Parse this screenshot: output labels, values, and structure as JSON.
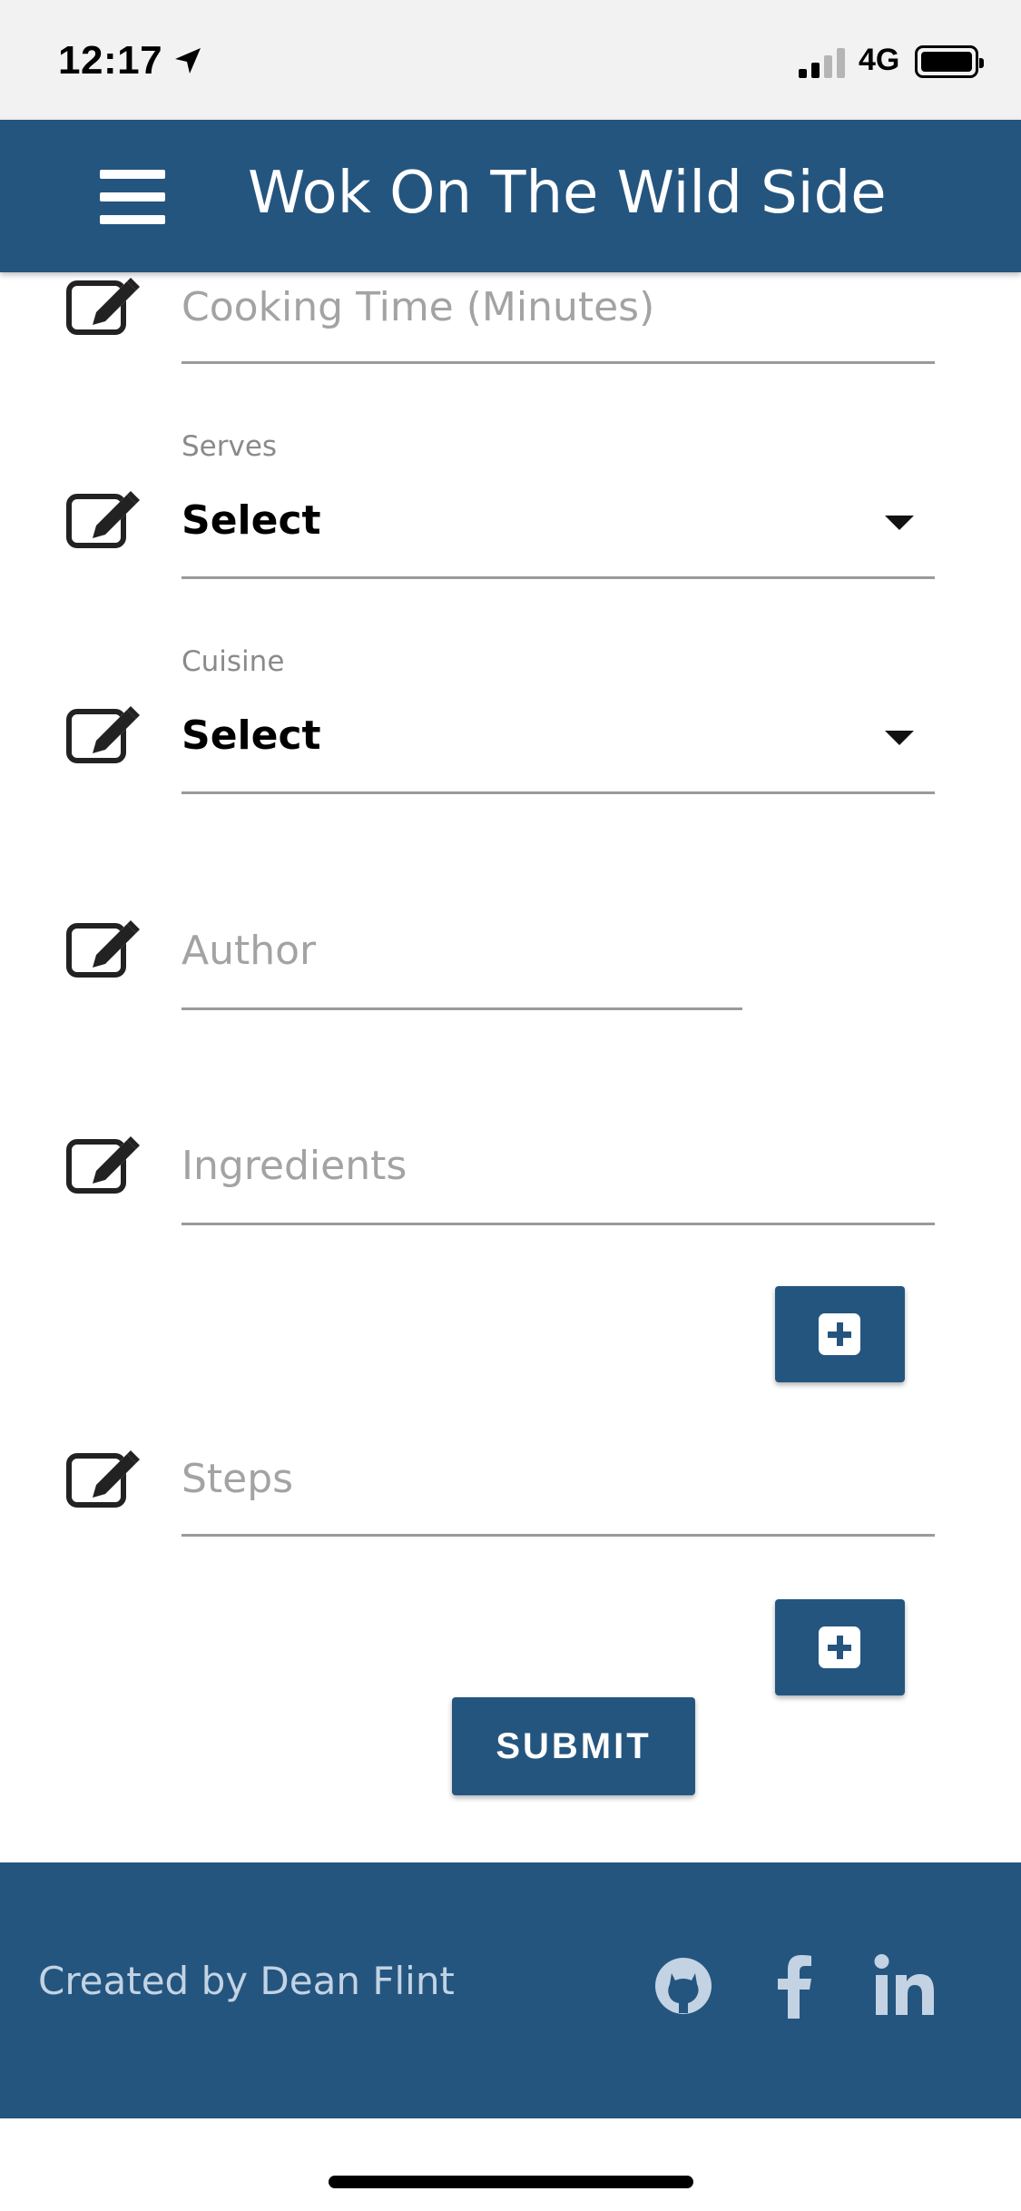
{
  "status_bar": {
    "time": "12:17",
    "network": "4G"
  },
  "app_bar": {
    "title": "Wok On The Wild Side"
  },
  "form": {
    "cooking_time": {
      "placeholder": "Cooking Time (Minutes)"
    },
    "serves": {
      "label": "Serves",
      "value": "Select"
    },
    "cuisine": {
      "label": "Cuisine",
      "value": "Select"
    },
    "author": {
      "placeholder": "Author"
    },
    "ingredients": {
      "placeholder": "Ingredients"
    },
    "steps": {
      "placeholder": "Steps"
    },
    "submit_label": "SUBMIT"
  },
  "footer": {
    "credit": "Created by Dean Flint",
    "social": [
      "github-icon",
      "facebook-icon",
      "linkedin-icon"
    ]
  },
  "colors": {
    "primary": "#24557f",
    "footer_text": "#c3d3e3",
    "placeholder": "#a3a3a3"
  }
}
